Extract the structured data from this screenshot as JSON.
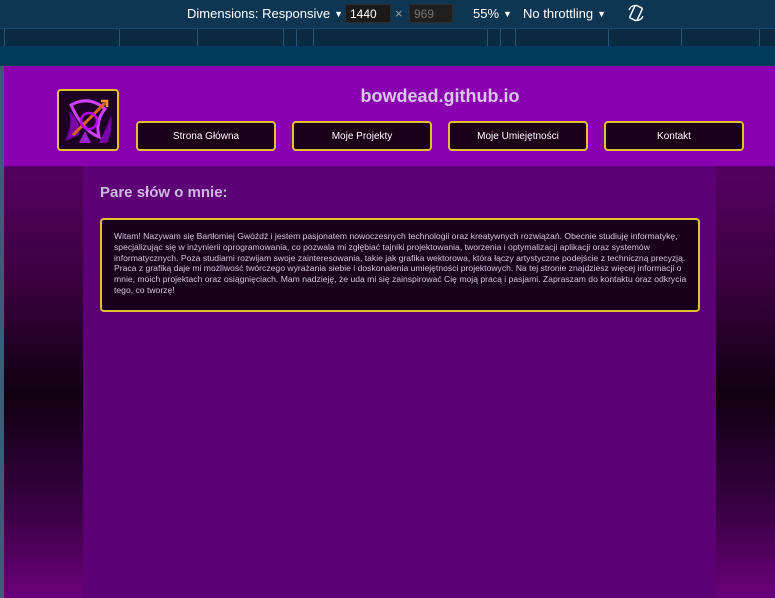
{
  "devtools": {
    "dimensions_label": "Dimensions: Responsive",
    "width_value": "1440",
    "height_placeholder": "969",
    "times": "×",
    "zoom": "55%",
    "throttling": "No throttling"
  },
  "site": {
    "title": "bowdead.github.io",
    "nav": [
      {
        "label": "Strona Główna"
      },
      {
        "label": "Moje Projekty"
      },
      {
        "label": "Moje Umiejętności"
      },
      {
        "label": "Kontakt"
      }
    ],
    "section_title": "Pare słów o mnie:",
    "about_text": "Witam! Nazywam się Bartłomiej Gwóźdź i jestem pasjonatem nowoczesnych technologii oraz kreatywnych rozwiązań. Obecnie studiuję informatykę, specjalizując się w inżynierii oprogramowania, co pozwala mi zgłębiać tajniki projektowania, tworzenia i optymalizacji aplikacji oraz systemów informatycznych. Poza studiami rozwijam swoje zainteresowania, takie jak grafika wektorowa, która łączy artystyczne podejście z techniczną precyzją. Praca z grafiką daje mi możliwość twórczego wyrażania siebie i doskonalenia umiejętności projektowych. Na tej stronie znajdziesz więcej informacji o mnie, moich projektach oraz osiągnięciach. Mam nadzieję, że uda mi się zainspirować Cię moją pracą i pasjami. Zapraszam do kontaktu oraz odkrycia tego, co tworzę!"
  },
  "colors": {
    "header": "#8a00b0",
    "accent_border": "#e0c130",
    "content_bg": "#5e0075",
    "button_bg": "#1a0019"
  }
}
